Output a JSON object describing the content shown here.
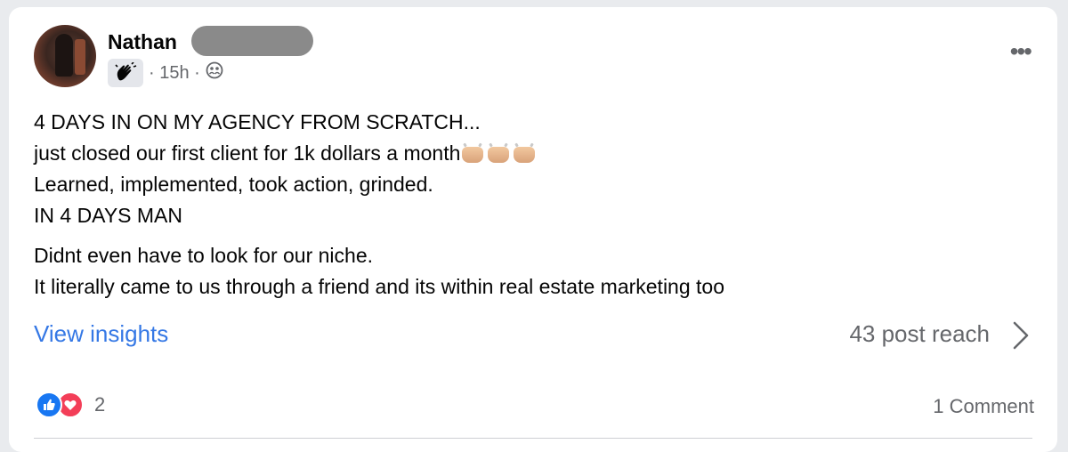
{
  "author": {
    "name": "Nathan"
  },
  "meta": {
    "time": "· 15h ·"
  },
  "post": {
    "line1": "4 DAYS IN ON MY AGENCY FROM SCRATCH...",
    "line2": "just closed our first client for 1k dollars a month",
    "line3": "Learned, implemented, took action, grinded.",
    "line4": "IN 4 DAYS MAN",
    "line5": "Didnt even have to look for our niche.",
    "line6": "It literally came to us through a friend and its within real estate marketing too"
  },
  "insights": {
    "link": "View insights",
    "reach": "43 post reach"
  },
  "footer": {
    "reaction_count": "2",
    "comments": "1 Comment"
  },
  "colors": {
    "link": "#3578e5",
    "like": "#1877f2",
    "love": "#f33e58",
    "muted": "#65676b"
  },
  "icons": [
    "avatar",
    "wave-badge-icon",
    "group-icon",
    "more-icon",
    "chevron-right-icon",
    "like-icon",
    "love-icon"
  ]
}
